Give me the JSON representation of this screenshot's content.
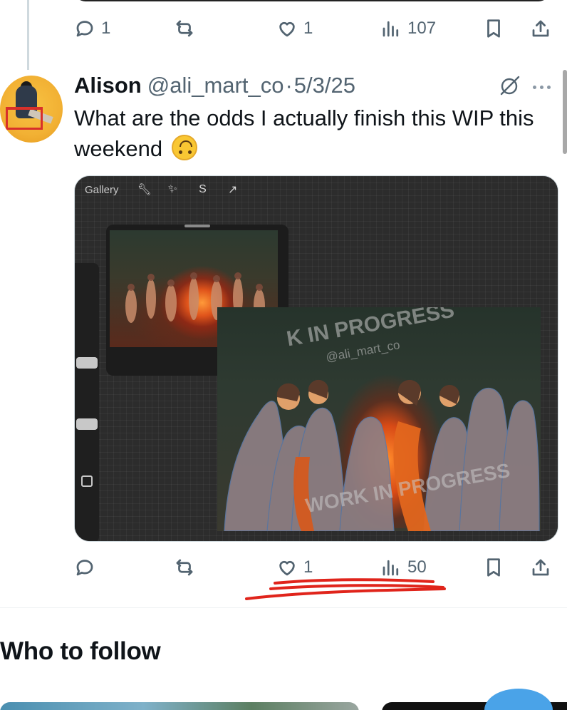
{
  "prev_post": {
    "actions": {
      "reply_count": "1",
      "repost_count": "",
      "like_count": "1",
      "views_count": "107"
    }
  },
  "post": {
    "author_name": "Alison",
    "author_handle": "@ali_mart_co",
    "separator": "·",
    "date": "5/3/25",
    "text": "What are the odds I actually finish this WIP this weekend",
    "emoji": "upside-down-face",
    "media": {
      "app_toolbar": {
        "gallery_label": "Gallery",
        "tools": [
          "wrench-icon",
          "magic-wand-icon",
          "selection-icon",
          "arrow-icon"
        ]
      },
      "watermarks": {
        "top": "K IN PROGRESS",
        "handle": "@ali_mart_co",
        "bottom": "WORK IN PROGRESS"
      }
    },
    "actions": {
      "reply_count": "",
      "repost_count": "",
      "like_count": "1",
      "views_count": "50"
    }
  },
  "sections": {
    "who_to_follow": "Who to follow"
  },
  "colors": {
    "text_primary": "#0f1419",
    "text_secondary": "#536471",
    "annotation_red": "#e0241b",
    "avatar_bg": "#f2b134"
  }
}
